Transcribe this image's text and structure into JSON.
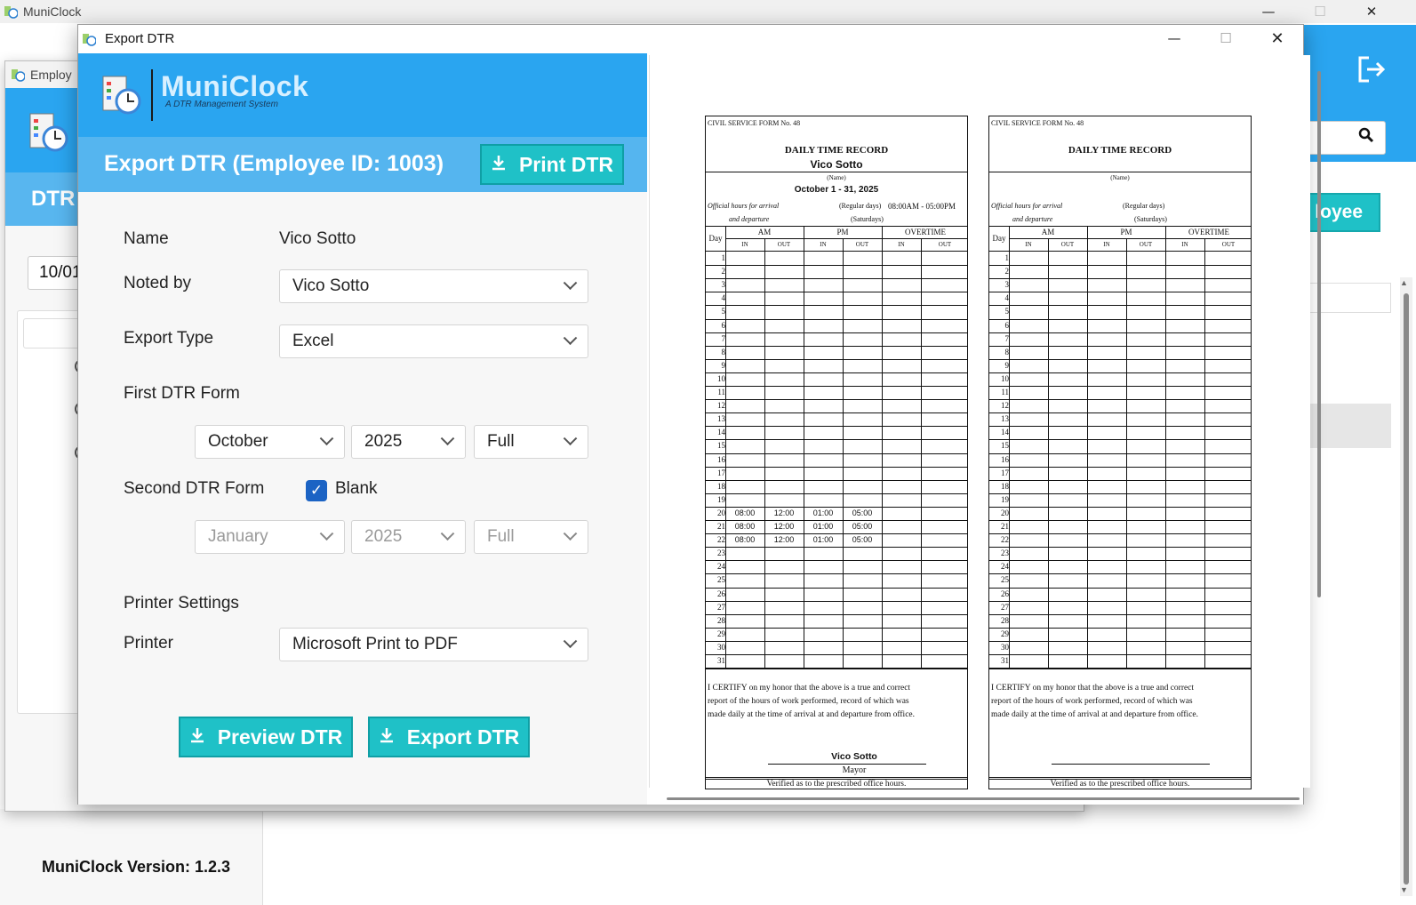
{
  "main_window": {
    "title": "MuniClock",
    "version": "MuniClock Version: 1.2.3",
    "add_button_partial": "loyee",
    "controls": {
      "minimize": "—",
      "maximize": "☐",
      "close": "✕"
    }
  },
  "employee_window": {
    "title": "Employ",
    "tab_label": "DTR",
    "date_value": "10/01"
  },
  "export_window": {
    "title": "Export DTR",
    "controls": {
      "minimize": "—",
      "maximize": "☐",
      "close": "✕"
    },
    "brand": {
      "name": "MuniClock",
      "tagline": "A DTR Management System"
    },
    "heading": "Export DTR (Employee ID: 1003)",
    "print_button": "Print DTR",
    "form": {
      "name_label": "Name",
      "name_value": "Vico Sotto",
      "noted_by_label": "Noted by",
      "noted_by_value": "Vico Sotto",
      "export_type_label": "Export Type",
      "export_type_value": "Excel",
      "first_form_label": "First DTR Form",
      "first_month": "October",
      "first_year": "2025",
      "first_range": "Full",
      "second_form_label": "Second DTR Form",
      "blank_label": "Blank",
      "blank_checked": true,
      "second_month": "January",
      "second_year": "2025",
      "second_range": "Full",
      "printer_settings_label": "Printer Settings",
      "printer_label": "Printer",
      "printer_value": "Microsoft Print to PDF"
    },
    "preview_button": "Preview DTR",
    "export_button": "Export DTR"
  },
  "dtr_forms": [
    {
      "form_no": "CIVIL SERVICE FORM No. 48",
      "title": "DAILY TIME RECORD",
      "employee_name": "Vico Sotto",
      "name_caption": "(Name)",
      "period": "October 1 - 31, 2025",
      "official_hours": "Official hours for arrival",
      "and_departure": "and departure",
      "regular_days": "(Regular days)",
      "regular_time": "08:00AM - 05:00PM",
      "saturdays": "(Saturdays)",
      "headers": {
        "day": "Day",
        "am": "AM",
        "pm": "PM",
        "overtime": "OVERTIME",
        "in": "IN",
        "out": "OUT"
      },
      "entries": [
        {
          "day": 20,
          "am_in": "08:00",
          "am_out": "12:00",
          "pm_in": "01:00",
          "pm_out": "05:00"
        },
        {
          "day": 21,
          "am_in": "08:00",
          "am_out": "12:00",
          "pm_in": "01:00",
          "pm_out": "05:00"
        },
        {
          "day": 22,
          "am_in": "08:00",
          "am_out": "12:00",
          "pm_in": "01:00",
          "pm_out": "05:00"
        }
      ],
      "certification": "I CERTIFY on my honor that the above is a true and correct report of the hours of work performed, record of which was made daily at the time of arrival at and departure from office.",
      "signatory_name": "Vico Sotto",
      "signatory_title": "Mayor",
      "verified": "Verified as to the prescribed office hours."
    },
    {
      "form_no": "CIVIL SERVICE FORM No. 48",
      "title": "DAILY TIME RECORD",
      "employee_name": "",
      "name_caption": "(Name)",
      "period": "",
      "official_hours": "Official hours for arrival",
      "and_departure": "and departure",
      "regular_days": "(Regular days)",
      "regular_time": "",
      "saturdays": "(Saturdays)",
      "headers": {
        "day": "Day",
        "am": "AM",
        "pm": "PM",
        "overtime": "OVERTIME",
        "in": "IN",
        "out": "OUT"
      },
      "entries": [],
      "certification": "I CERTIFY on my honor that the above is a true and correct report of the hours of work performed, record of which was made daily at the time of arrival at and departure from office.",
      "signatory_name": "",
      "signatory_title": "",
      "verified": "Verified as to the prescribed office hours."
    }
  ],
  "colors": {
    "brand_blue": "#2aa5f0",
    "header_blue": "#55b5ef",
    "teal": "#1fc1c7",
    "check_blue": "#1b63c4"
  }
}
